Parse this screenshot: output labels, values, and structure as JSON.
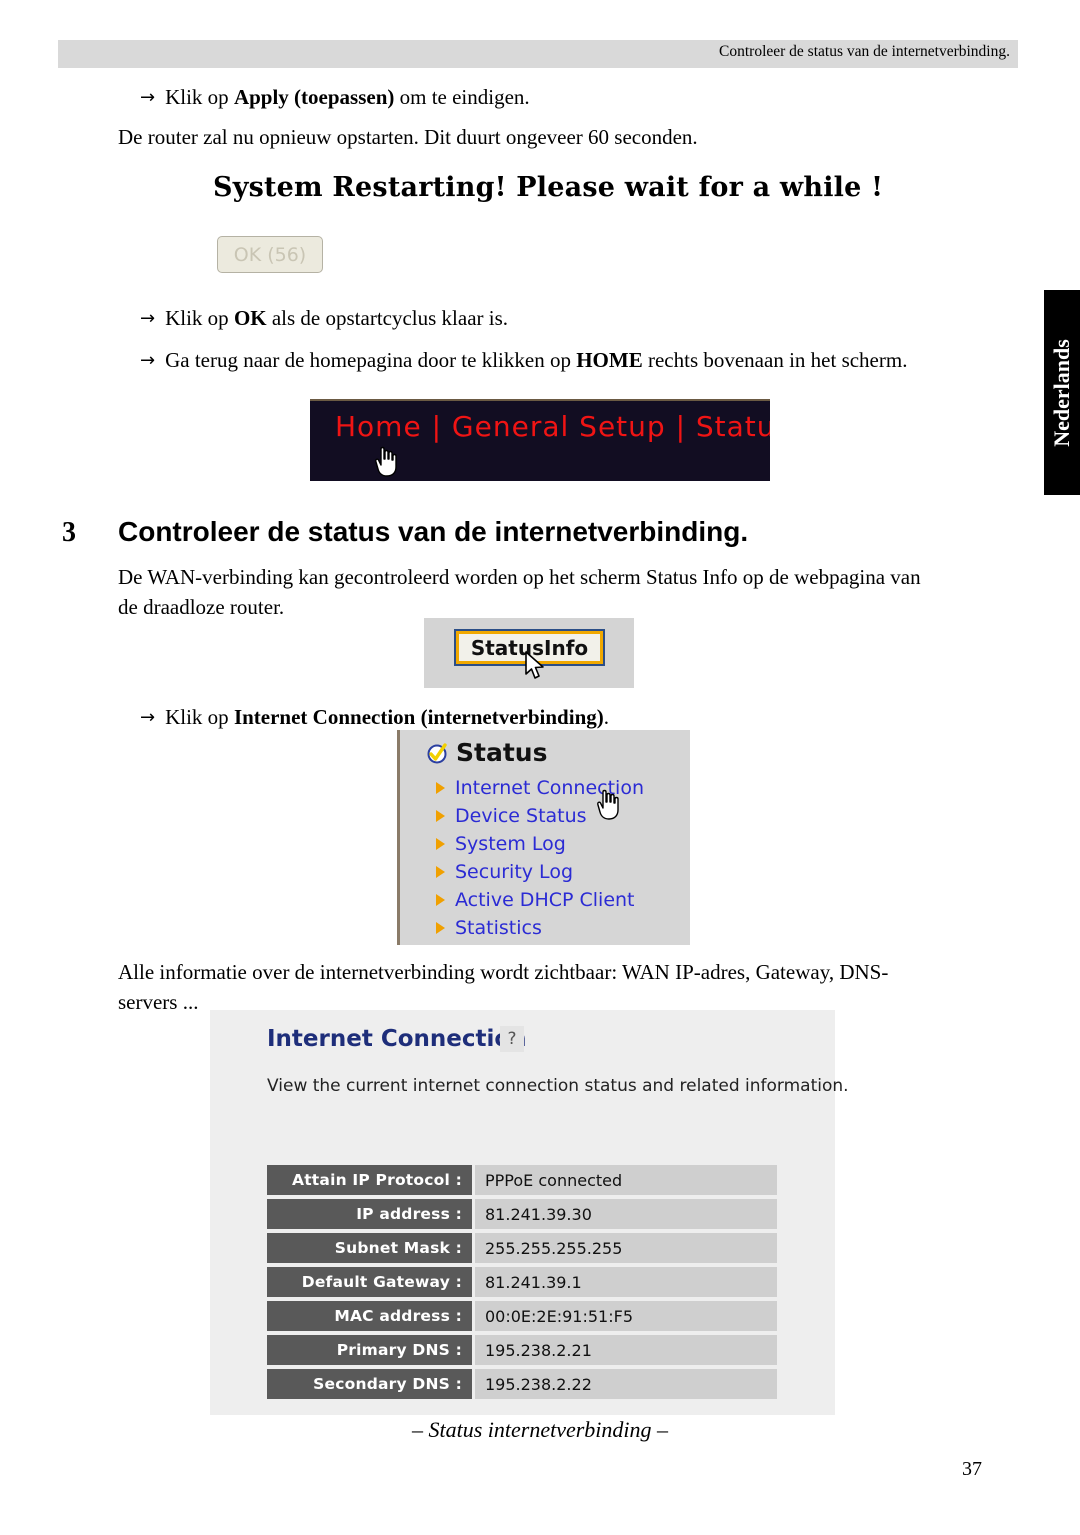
{
  "header": {
    "running_head": "Controleer de status van de internetverbinding."
  },
  "body": {
    "line_apply_prefix": "Klik op ",
    "line_apply_bold": "Apply (toepassen)",
    "line_apply_suffix": " om te eindigen.",
    "para_reboot": "De router zal nu opnieuw opstarten. Dit duurt ongeveer 60 seconden.",
    "line_ok_prefix": "Klik op ",
    "line_ok_bold": "OK",
    "line_ok_suffix": " als de opstartcyclus klaar is.",
    "line_home_prefix": "Ga terug naar de homepagina door te klikken op ",
    "line_home_bold": "HOME",
    "line_home_suffix": " rechts bovenaan in het scherm.",
    "line_ic_prefix": "Klik op ",
    "line_ic_bold": "Internet Connection (internetverbinding)",
    "line_ic_suffix": ".",
    "para_info_l1": "Alle informatie over de internetverbinding wordt zichtbaar: WAN IP-adres, Gateway, DNS-",
    "para_info_l2": "servers ...",
    "arrow": "→"
  },
  "heading": {
    "number": "3",
    "title": "Controleer de status van de internetverbinding.",
    "intro_l1": "De WAN-verbinding kan gecontroleerd worden op het scherm Status Info op de webpagina van",
    "intro_l2": "de draadloze router."
  },
  "restart_screenshot": {
    "title": "System Restarting! Please wait for a while !",
    "ok_button_label": "OK (56)"
  },
  "nav_screenshot": {
    "text": "Home | General Setup | Status | Tool |",
    "text_color": "#f01414",
    "background": "#120d22"
  },
  "statusinfo_screenshot": {
    "button_label": "StatusInfo",
    "border_color": "#f0a800",
    "outline_color": "#2b4e87"
  },
  "status_panel": {
    "heading": "Status",
    "items": [
      {
        "label": "Internet Connection"
      },
      {
        "label": "Device Status"
      },
      {
        "label": "System Log"
      },
      {
        "label": "Security Log"
      },
      {
        "label": "Active DHCP Client"
      },
      {
        "label": "Statistics"
      }
    ],
    "link_color": "#2b2bd4",
    "bullet_color": "#f0a000"
  },
  "internet_connection_panel": {
    "title": "Internet Connection",
    "title_icon": "help-icon",
    "description": "View the current internet connection status and related information.",
    "rows": [
      {
        "label": "Attain IP Protocol :",
        "value": "PPPoE connected"
      },
      {
        "label": "IP address :",
        "value": "81.241.39.30"
      },
      {
        "label": "Subnet Mask :",
        "value": "255.255.255.255"
      },
      {
        "label": "Default Gateway :",
        "value": "81.241.39.1"
      },
      {
        "label": "MAC address :",
        "value": "00:0E:2E:91:51:F5"
      },
      {
        "label": "Primary DNS :",
        "value": "195.238.2.21"
      },
      {
        "label": "Secondary DNS :",
        "value": "195.238.2.22"
      }
    ],
    "label_bg": "#595959",
    "value_bg": "#cfcfcf"
  },
  "caption": "– Status internetverbinding –",
  "side_tab": {
    "label": "Nederlands"
  },
  "page_number": "37"
}
